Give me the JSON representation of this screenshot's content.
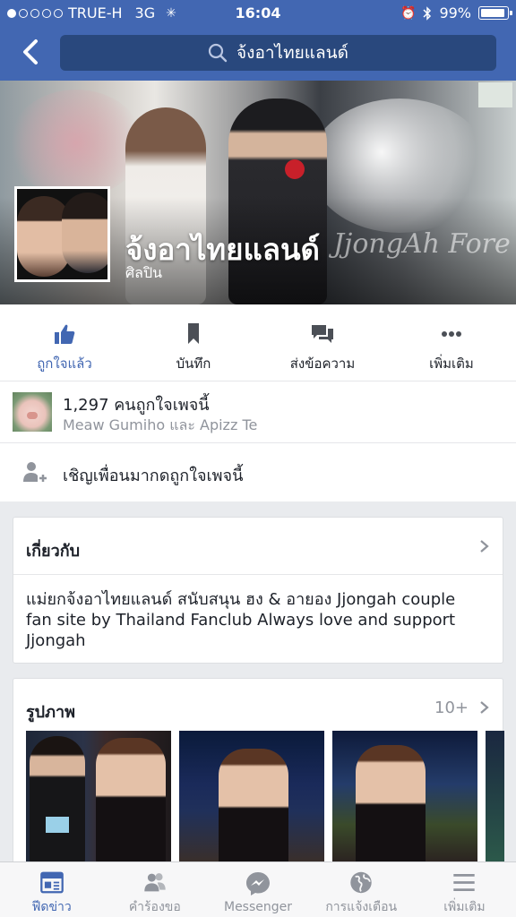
{
  "status_bar": {
    "carrier": "TRUE-H",
    "network": "3G",
    "time": "16:04",
    "battery": "99%",
    "battery_level": 0.99
  },
  "nav": {
    "search_text": "จ้งอาไทยแลนด์"
  },
  "page": {
    "name": "จ้งอาไทยแลนด์",
    "category": "ศิลปิน",
    "cover_watermark": "JjongAh Fore"
  },
  "actions": [
    {
      "label": "ถูกใจแล้ว",
      "icon": "thumbs-up-icon"
    },
    {
      "label": "บันทึก",
      "icon": "bookmark-icon"
    },
    {
      "label": "ส่งข้อความ",
      "icon": "message-icon"
    },
    {
      "label": "เพิ่มเติม",
      "icon": "more-icon"
    }
  ],
  "likes": {
    "count_text": "1,297 คนถูกใจเพจนี้",
    "friends_text": "Meaw Gumiho และ Apizz Te"
  },
  "invite": {
    "label": "เชิญเพื่อนมากดถูกใจเพจนี้"
  },
  "about": {
    "title": "เกี่ยวกับ",
    "description": "แม่ยกจ้งอาไทยแลนด์ สนับสนุน ฮง & อายอง  Jjongah couple fan site by Thailand Fanclub Always love and support Jjongah"
  },
  "photos": {
    "title": "รูปภาพ",
    "count": "10+"
  },
  "tabs": [
    {
      "label": "ฟีดข่าว",
      "icon": "news-feed-icon",
      "active": true
    },
    {
      "label": "คำร้องขอ",
      "icon": "friend-requests-icon",
      "active": false
    },
    {
      "label": "Messenger",
      "icon": "messenger-icon",
      "active": false
    },
    {
      "label": "การแจ้งเตือน",
      "icon": "globe-icon",
      "active": false
    },
    {
      "label": "เพิ่มเติม",
      "icon": "menu-icon",
      "active": false
    }
  ],
  "colors": {
    "brand": "#4267b2",
    "search_bg": "#29487d",
    "text": "#1d2129",
    "muted": "#90949c"
  }
}
